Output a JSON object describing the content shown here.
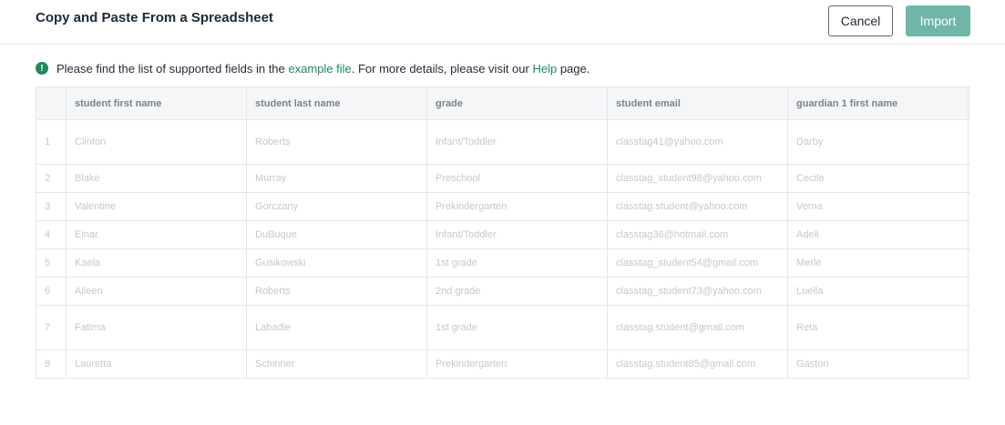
{
  "header": {
    "title": "Copy and Paste From a Spreadsheet",
    "cancel_label": "Cancel",
    "import_label": "Import"
  },
  "info": {
    "icon": "exclamation-circle-icon",
    "text_before": "Please find the list of supported fields in the ",
    "example_link": "example file",
    "text_middle": ". For more details, please visit our ",
    "help_link": "Help",
    "text_after": " page."
  },
  "colors": {
    "accent": "#1f8a5c",
    "import_button": "#6fb5a8"
  },
  "table": {
    "columns": [
      "student first name",
      "student last name",
      "grade",
      "student email",
      "guardian 1 first name"
    ],
    "rows": [
      {
        "num": "1",
        "cells": [
          "Clinton",
          "Roberts",
          "Infant/Toddler",
          "classtag41@yahoo.com",
          "Darby"
        ]
      },
      {
        "num": "2",
        "cells": [
          "Blake",
          "Murray",
          "Preschool",
          "classtag_student98@yahoo.com",
          "Cecile"
        ]
      },
      {
        "num": "3",
        "cells": [
          "Valentine",
          "Gorczany",
          "Prekindergarten",
          "classtag.student@yahoo.com",
          "Verna"
        ]
      },
      {
        "num": "4",
        "cells": [
          "Einar",
          "DuBuque",
          "Infant/Toddler",
          "classtag36@hotmail.com",
          "Adell"
        ]
      },
      {
        "num": "5",
        "cells": [
          "Kaela",
          "Gusikowski",
          "1st grade",
          "classtag_student54@gmail.com",
          "Merle"
        ]
      },
      {
        "num": "6",
        "cells": [
          "Aileen",
          "Roberts",
          "2nd grade",
          "classtag_student73@yahoo.com",
          "Luella"
        ]
      },
      {
        "num": "7",
        "cells": [
          "Fatima",
          "Labadie",
          "1st grade",
          "classtag.student@gmail.com",
          "Reta"
        ]
      },
      {
        "num": "8",
        "cells": [
          "Lauretta",
          "Schinner",
          "Prekindergarten",
          "classtag.student85@gmail.com",
          "Gaston"
        ]
      }
    ]
  }
}
